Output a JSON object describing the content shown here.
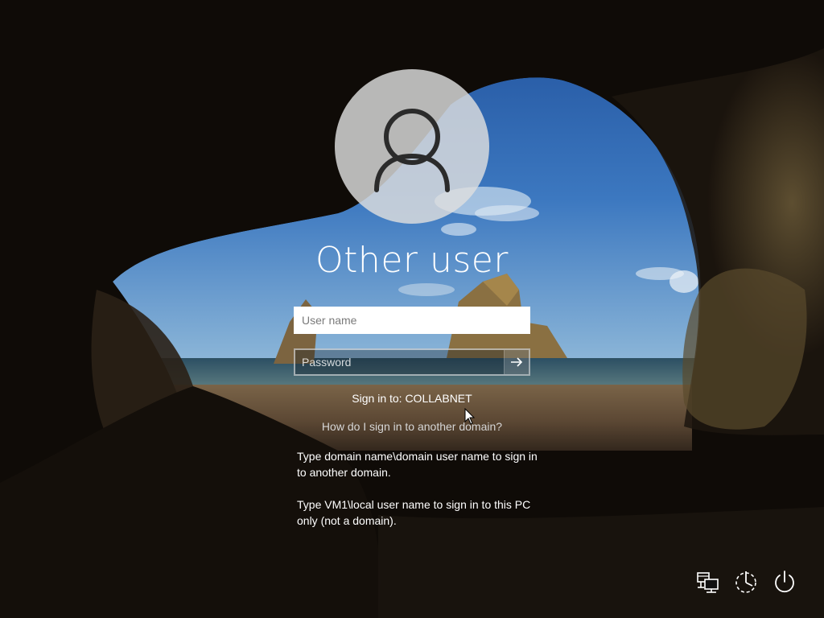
{
  "login": {
    "title": "Other user",
    "username_placeholder": "User name",
    "password_placeholder": "Password",
    "sign_in_to": "Sign in to: COLLABNET",
    "help_link": "How do I sign in to another domain?",
    "info_line1": "Type domain name\\domain user name to sign in to another domain.",
    "info_line2": "Type VM1\\local user name to sign in to this PC only (not a domain)."
  },
  "icons": {
    "avatar": "user-avatar-icon",
    "submit": "arrow-right-icon",
    "network": "network-icon",
    "ease_of_access": "ease-of-access-icon",
    "power": "power-icon"
  },
  "colors": {
    "text": "#ffffff",
    "link": "#d6d6d6",
    "avatar_bg": "#dedede"
  }
}
